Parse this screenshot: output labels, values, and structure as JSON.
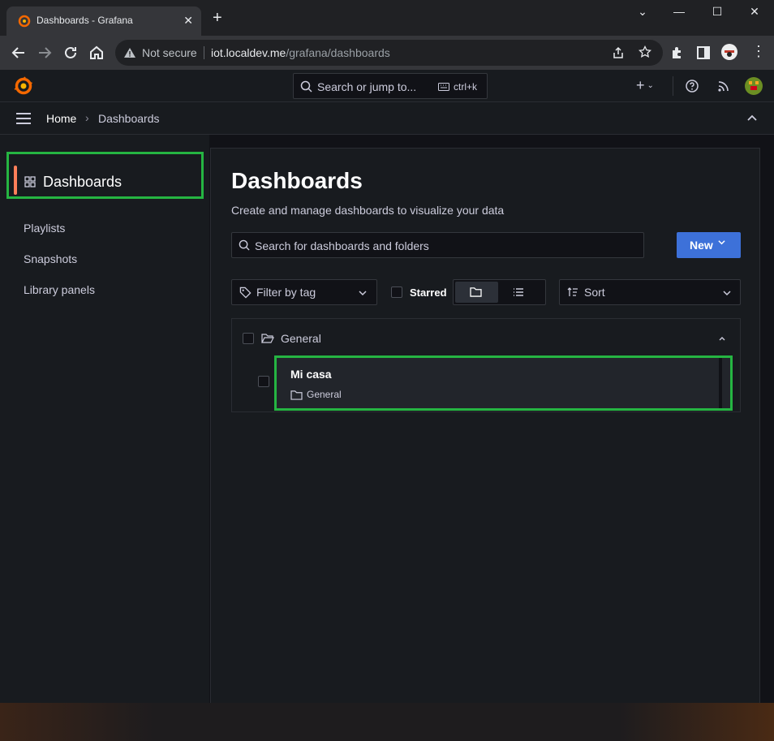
{
  "browser": {
    "tab_title": "Dashboards - Grafana",
    "security_label": "Not secure",
    "url_host": "iot.localdev.me",
    "url_path": "/grafana/dashboards"
  },
  "topbar": {
    "search_placeholder": "Search or jump to...",
    "shortcut": "ctrl+k",
    "add_label": "+"
  },
  "breadcrumb": {
    "home": "Home",
    "current": "Dashboards"
  },
  "sidebar": {
    "title": "Dashboards",
    "items": [
      {
        "label": "Playlists"
      },
      {
        "label": "Snapshots"
      },
      {
        "label": "Library panels"
      }
    ]
  },
  "main": {
    "title": "Dashboards",
    "subtitle": "Create and manage dashboards to visualize your data",
    "search_placeholder": "Search for dashboards and folders",
    "new_button": "New",
    "filter_tag": "Filter by tag",
    "starred": "Starred",
    "sort": "Sort"
  },
  "results": {
    "folder": "General",
    "dashboards": [
      {
        "name": "Mi casa",
        "folder": "General"
      }
    ]
  },
  "colors": {
    "highlight": "#25b542",
    "accent": "#ff7f5a",
    "primary_button": "#3d71d9"
  }
}
